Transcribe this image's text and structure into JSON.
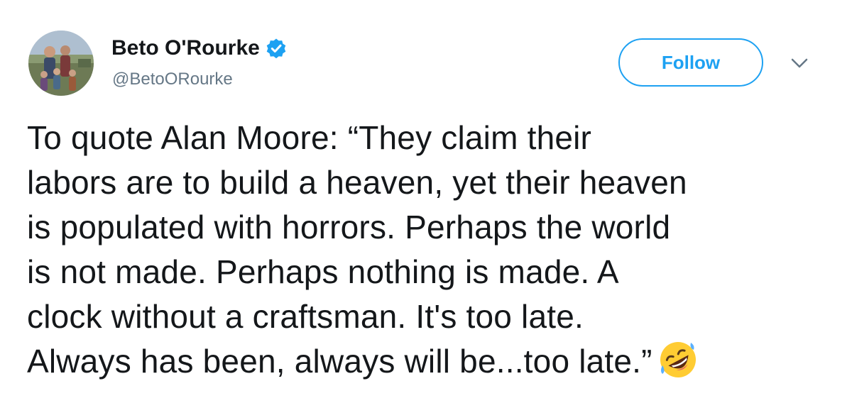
{
  "author": {
    "display_name": "Beto O'Rourke",
    "handle": "@BetoORourke",
    "verified": true,
    "avatar_icon": "profile-photo"
  },
  "actions": {
    "follow_label": "Follow",
    "menu_icon": "chevron-down-icon"
  },
  "tweet": {
    "lines": [
      "To quote Alan Moore: “They claim their",
      "labors are to build a heaven, yet their heaven",
      "is populated with horrors. Perhaps the world",
      "is not made. Perhaps nothing is made. A",
      "clock without a craftsman. It's too late.",
      "Always has been, always will be...too late.”"
    ],
    "emoji": "rolling-on-the-floor-laughing"
  },
  "colors": {
    "accent": "#1da1f2",
    "text": "#14171a",
    "secondary": "#657786"
  }
}
